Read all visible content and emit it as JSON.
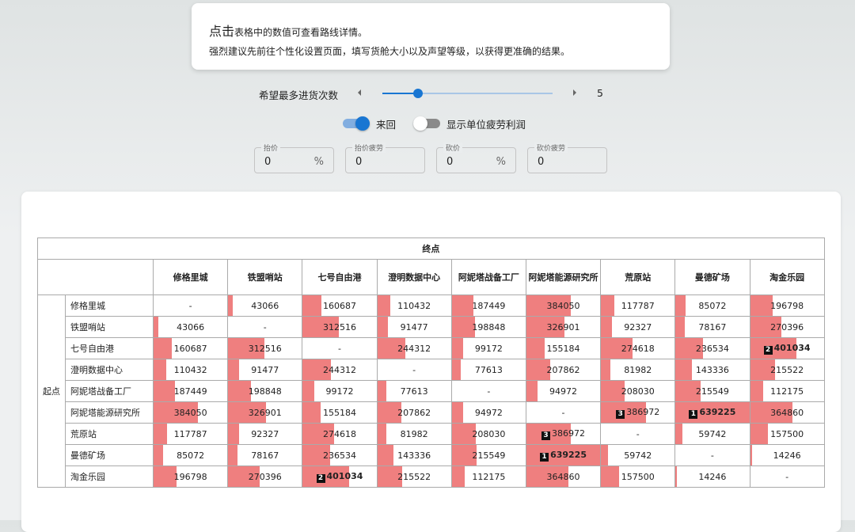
{
  "notice": {
    "lead": "点击",
    "line1": "表格中的数值可查看路线详情。",
    "line2": "强烈建议先前往个性化设置页面，填写货舱大小以及声望等级，以获得更准确的结果。"
  },
  "slider": {
    "label": "希望最多进货次数",
    "value": "5",
    "min": 1,
    "max": 20,
    "current": 5
  },
  "toggles": [
    {
      "label": "来回",
      "on": true
    },
    {
      "label": "显示单位疲劳利润",
      "on": false
    }
  ],
  "inputs": [
    {
      "label": "抬价",
      "value": "0",
      "unit": "%"
    },
    {
      "label": "抬价疲劳",
      "value": "0",
      "unit": ""
    },
    {
      "label": "砍价",
      "value": "0",
      "unit": "%"
    },
    {
      "label": "砍价疲劳",
      "value": "0",
      "unit": ""
    }
  ],
  "table": {
    "dest_header": "终点",
    "origin_header": "起点",
    "stations": [
      "修格里城",
      "铁盟哨站",
      "七号自由港",
      "澄明数据中心",
      "阿妮塔战备工厂",
      "阿妮塔能源研究所",
      "荒原站",
      "曼德矿场",
      "淘金乐园"
    ],
    "max": 639225,
    "values": [
      [
        null,
        43066,
        160687,
        110432,
        187449,
        384050,
        117787,
        85072,
        196798
      ],
      [
        43066,
        null,
        312516,
        91477,
        198848,
        326901,
        92327,
        78167,
        270396
      ],
      [
        160687,
        312516,
        null,
        244312,
        99172,
        155184,
        274618,
        236534,
        401034
      ],
      [
        110432,
        91477,
        244312,
        null,
        77613,
        207862,
        81982,
        143336,
        215522
      ],
      [
        187449,
        198848,
        99172,
        77613,
        null,
        94972,
        208030,
        215549,
        112175
      ],
      [
        384050,
        326901,
        155184,
        207862,
        94972,
        null,
        386972,
        639225,
        364860
      ],
      [
        117787,
        92327,
        274618,
        81982,
        208030,
        386972,
        null,
        59742,
        157500
      ],
      [
        85072,
        78167,
        236534,
        143336,
        215549,
        639225,
        59742,
        null,
        14246
      ],
      [
        196798,
        270396,
        401034,
        215522,
        112175,
        364860,
        157500,
        14246,
        null
      ]
    ],
    "ranks": {
      "639225": "1",
      "401034": "2",
      "386972": "3"
    },
    "empty": "-",
    "bar_color": "#ef7f7f"
  }
}
